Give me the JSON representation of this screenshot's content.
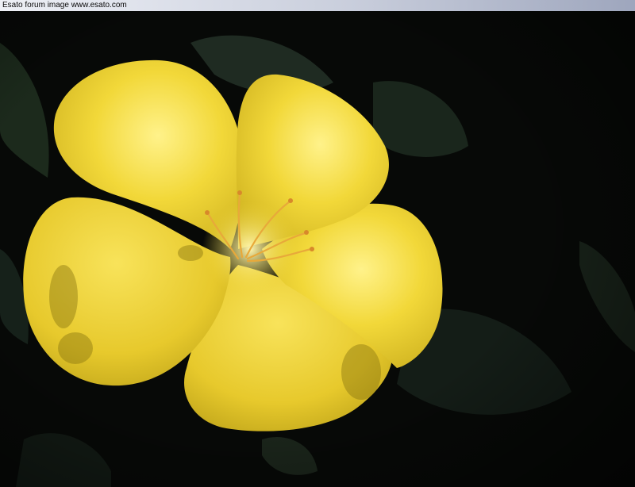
{
  "caption": {
    "text": "Esato forum image www.esato.com"
  },
  "photo": {
    "subject": "flower-photo",
    "colors": {
      "background": "#070907",
      "foliage": "#1c2a1c",
      "petal": "#f2d839",
      "petal_highlight": "#fff28a",
      "petal_shadow": "#b79d16",
      "stamen": "#e8a93a"
    }
  }
}
